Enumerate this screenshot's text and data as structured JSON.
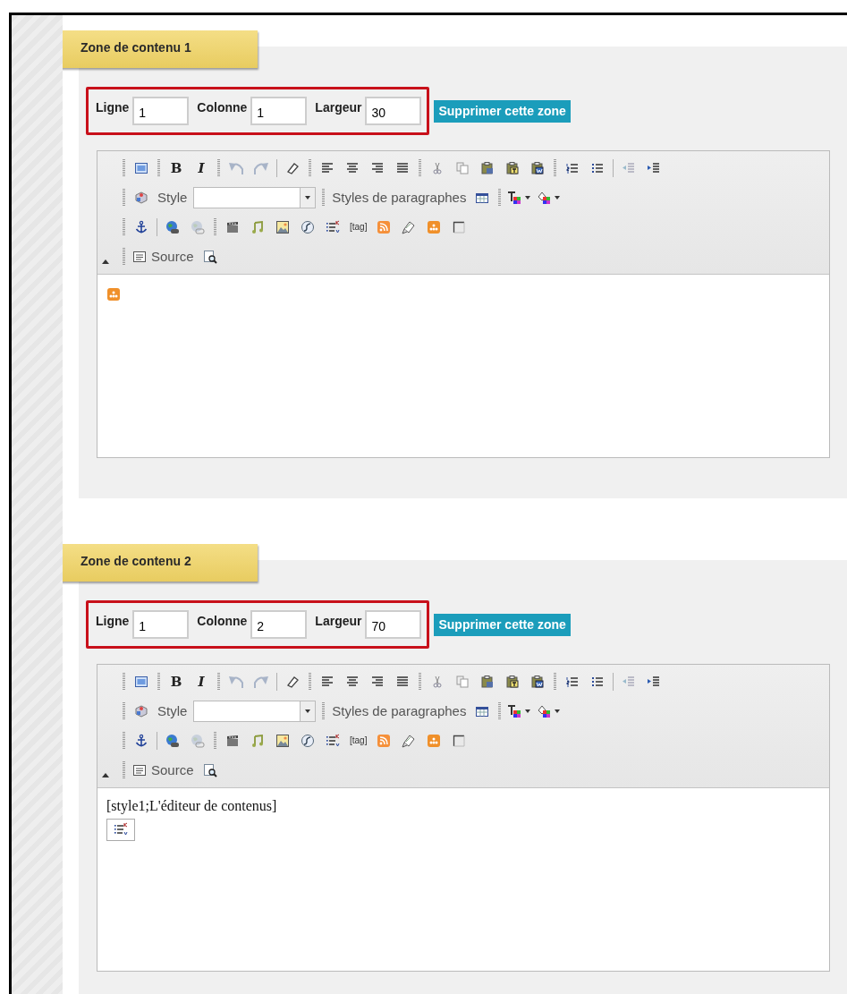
{
  "zones": [
    {
      "title": "Zone de contenu 1",
      "fields": [
        {
          "label": "Ligne",
          "value": "1"
        },
        {
          "label": "Colonne",
          "value": "1"
        },
        {
          "label": "Largeur",
          "value": "30"
        }
      ],
      "delete_button": "Supprimer cette zone",
      "toolbar": {
        "bold": "B",
        "italic": "I",
        "style_label": "Style",
        "paragraph_styles": "Styles de paragraphes",
        "tag": "[tag]",
        "source": "Source"
      },
      "content": [
        {
          "kind": "plugin-icon"
        }
      ]
    },
    {
      "title": "Zone de contenu 2",
      "fields": [
        {
          "label": "Ligne",
          "value": "1"
        },
        {
          "label": "Colonne",
          "value": "2"
        },
        {
          "label": "Largeur",
          "value": "70"
        }
      ],
      "delete_button": "Supprimer cette zone",
      "toolbar": {
        "bold": "B",
        "italic": "I",
        "style_label": "Style",
        "paragraph_styles": "Styles de paragraphes",
        "tag": "[tag]",
        "source": "Source"
      },
      "content": [
        {
          "kind": "text",
          "text": "[style1;L'éditeur de contenus]"
        },
        {
          "kind": "checklist-icon"
        }
      ]
    }
  ]
}
